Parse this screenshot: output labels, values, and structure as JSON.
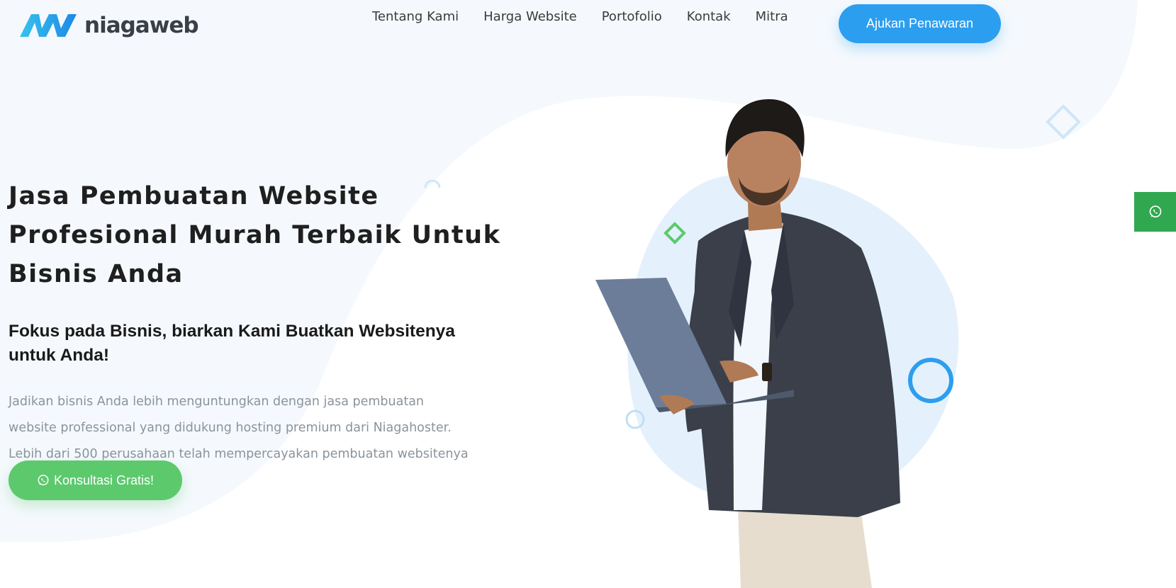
{
  "brand": {
    "name": "niagaweb",
    "logo_icon": "niagaweb-logo-mark"
  },
  "nav": {
    "items": [
      {
        "label": "Tentang Kami"
      },
      {
        "label": "Harga Website"
      },
      {
        "label": "Portofolio"
      },
      {
        "label": "Kontak"
      },
      {
        "label": "Mitra"
      }
    ],
    "cta_label": "Ajukan Penawaran"
  },
  "hero": {
    "title": "Jasa Pembuatan Website Profesional Murah Terbaik Untuk Bisnis Anda",
    "subtitle": "Fokus pada Bisnis, biarkan Kami Buatkan Websitenya untuk Anda!",
    "description": "Jadikan bisnis Anda lebih menguntungkan dengan jasa pembuatan website professional yang didukung hosting premium dari Niagahoster. Lebih dari 500 perusahaan telah mempercayakan pembuatan websitenya pada Niagaweb.",
    "cta_label": "Konsultasi Gratis!",
    "cta_icon": "whatsapp-icon"
  },
  "floating": {
    "icon": "whatsapp-icon"
  },
  "colors": {
    "primary_blue": "#2c9ef0",
    "whatsapp_green": "#5cc96d",
    "floating_green": "#30a84f",
    "background_tint": "#f5f9fd",
    "text_dark": "#1f1f1f",
    "text_muted": "#8a939c"
  }
}
